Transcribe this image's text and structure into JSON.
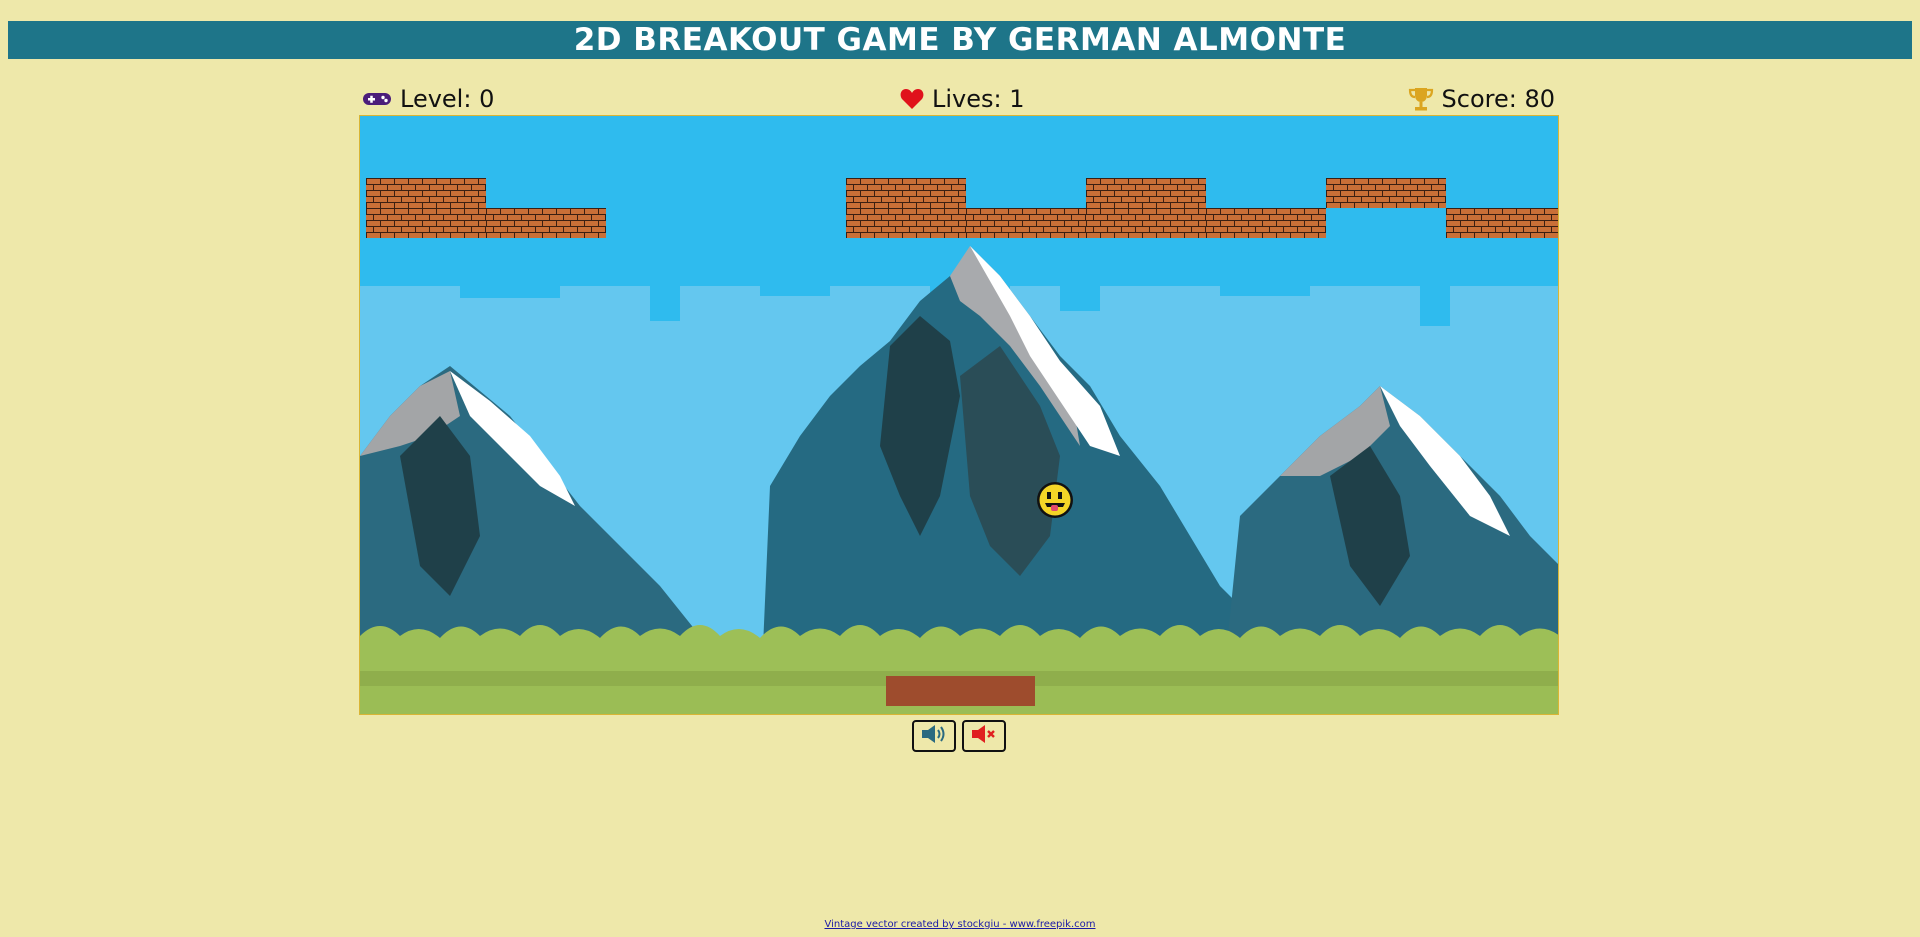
{
  "header": {
    "title": "2D BREAKOUT GAME BY GERMAN ALMONTE"
  },
  "hud": {
    "level_text": "Level: 0",
    "lives_text": "Lives: 1",
    "score_text": "Score: 80",
    "level_icon": "gamepad-icon",
    "lives_icon": "heart-icon",
    "score_icon": "trophy-icon"
  },
  "game": {
    "brick_color": "#c96f37",
    "paddle_color": "#9e4c2d",
    "ball_icon": "smiley-ball-icon",
    "bricks": [
      {
        "col": 0,
        "row": 0
      },
      {
        "col": 0,
        "row": 1
      },
      {
        "col": 1,
        "row": 1
      },
      {
        "col": 4,
        "row": 0
      },
      {
        "col": 4,
        "row": 1
      },
      {
        "col": 5,
        "row": 1
      },
      {
        "col": 6,
        "row": 0
      },
      {
        "col": 6,
        "row": 1
      },
      {
        "col": 7,
        "row": 1
      },
      {
        "col": 8,
        "row": 0
      },
      {
        "col": 9,
        "row": 1
      }
    ]
  },
  "controls": {
    "sound_on_icon": "volume-on-icon",
    "sound_off_icon": "volume-mute-icon"
  },
  "footer": {
    "credit_text": "Vintage vector created by stockgiu - www.freepik.com"
  }
}
